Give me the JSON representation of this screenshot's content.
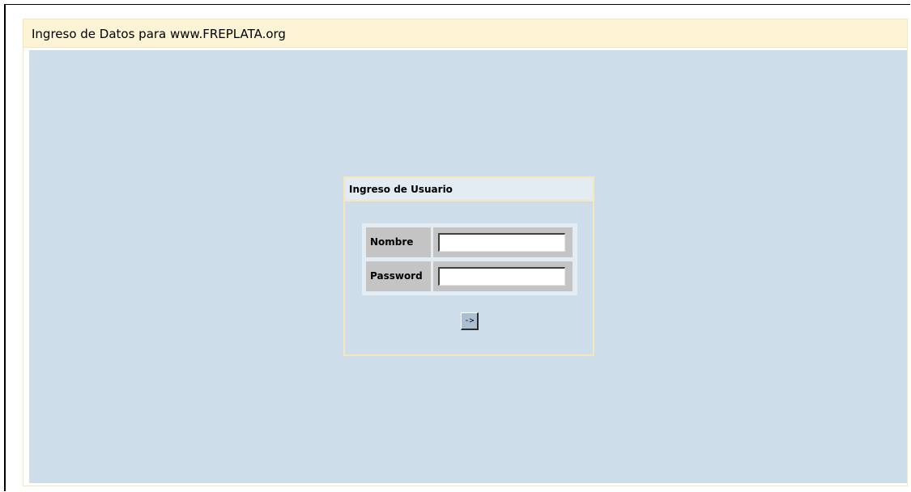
{
  "page": {
    "header_title": "Ingreso de Datos para www.FREPLATA.org"
  },
  "login": {
    "title": "Ingreso de Usuario",
    "fields": [
      {
        "label": "Nombre",
        "value": ""
      },
      {
        "label": "Password",
        "value": ""
      }
    ],
    "submit_label": "->"
  },
  "colors": {
    "header_bg": "#fdf4d6",
    "content_bg": "#cddde9",
    "login_border": "#f6e6ba",
    "label_cell_bg": "#c4c4c4",
    "button_bg": "#aac0d2"
  }
}
